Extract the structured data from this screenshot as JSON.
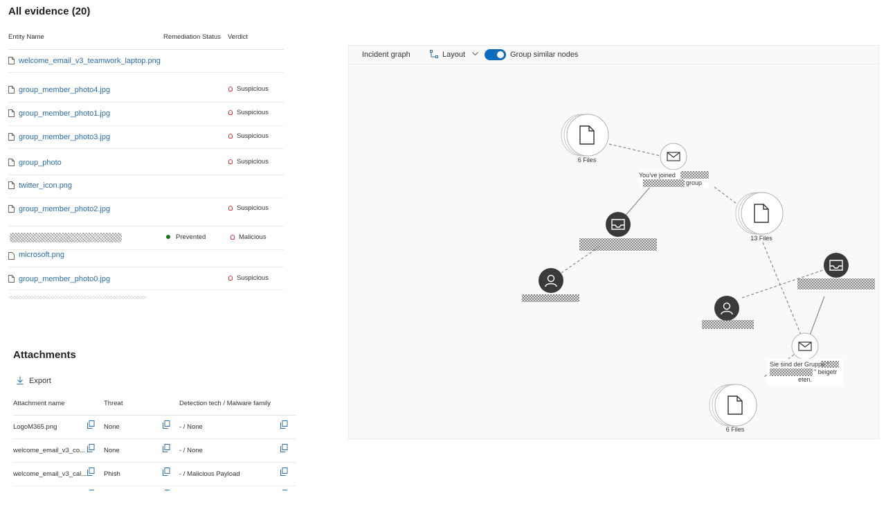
{
  "evidence": {
    "title": "All evidence (20)",
    "columns": {
      "entity": "Entity Name",
      "remediation": "Remediation Status",
      "verdict": "Verdict"
    },
    "rows": [
      {
        "name": "welcome_email_v3_teamwork_laptop.png",
        "status": "",
        "verdict": ""
      },
      {
        "name": "group_member_photo4.jpg",
        "status": "",
        "verdict": "Suspicious"
      },
      {
        "name": "group_member_photo1.jpg",
        "status": "",
        "verdict": "Suspicious"
      },
      {
        "name": "group_member_photo3.jpg",
        "status": "",
        "verdict": "Suspicious"
      },
      {
        "name": "group_photo",
        "status": "",
        "verdict": "Suspicious"
      },
      {
        "name": "twitter_icon.png",
        "status": "",
        "verdict": ""
      },
      {
        "name": "group_member_photo2.jpg",
        "status": "",
        "verdict": "Suspicious"
      },
      {
        "name": "",
        "status": "Prevented",
        "verdict": "Malicious"
      },
      {
        "name": "microsoft.png",
        "status": "",
        "verdict": ""
      },
      {
        "name": "group_member_photo0.jpg",
        "status": "",
        "verdict": "Suspicious"
      }
    ]
  },
  "attachments": {
    "title": "Attachments",
    "export_label": "Export",
    "columns": {
      "name": "Attachment name",
      "threat": "Threat",
      "detection": "Detection tech / Malware family"
    },
    "rows": [
      {
        "name": "LogoM365.png",
        "threat": "None",
        "detection": "- / None"
      },
      {
        "name": "welcome_email_v3_co...",
        "threat": "None",
        "detection": "- / None"
      },
      {
        "name": "welcome_email_v3_cal...",
        "threat": "Phish",
        "detection": "- / Malicious Payload"
      }
    ]
  },
  "graph": {
    "title": "Incident graph",
    "layout_label": "Layout",
    "group_label": "Group similar nodes",
    "group_enabled": true,
    "nodes": {
      "files_a": "6 Files",
      "email_a_line1": "You've joined",
      "email_a_line2": "group",
      "files_b": "13 Files",
      "email_b_line1": "Sie sind der Gruppe \"",
      "email_b_line2": "\" beigetr",
      "email_b_line3": "eten.",
      "files_c": "6 Files"
    }
  },
  "colors": {
    "link": "#2b6ca8",
    "suspicious": "#d13438",
    "prevented": "#107c10",
    "toggle": "#0f6cbd",
    "node_dark": "#3b3a39"
  }
}
